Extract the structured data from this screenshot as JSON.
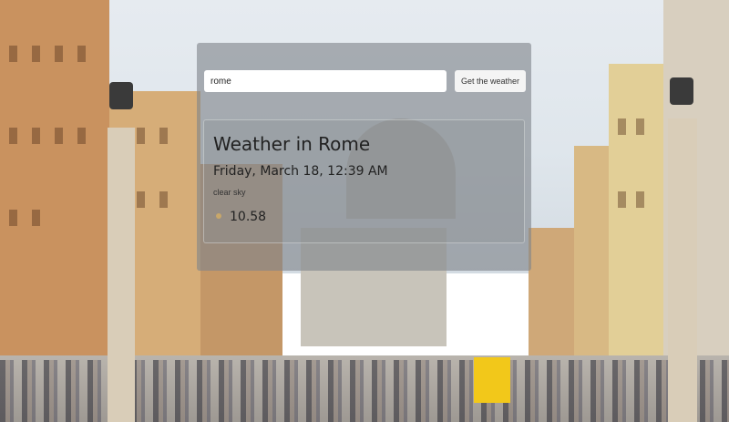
{
  "search": {
    "value": "rome",
    "button_label": "Get the weather"
  },
  "weather": {
    "title": "Weather in Rome",
    "datetime": "Friday, March 18, 12:39 AM",
    "description": "clear sky",
    "icon": "sun-icon",
    "temperature": "10.58"
  },
  "background": {
    "description_icon": "city-street-background-image"
  }
}
